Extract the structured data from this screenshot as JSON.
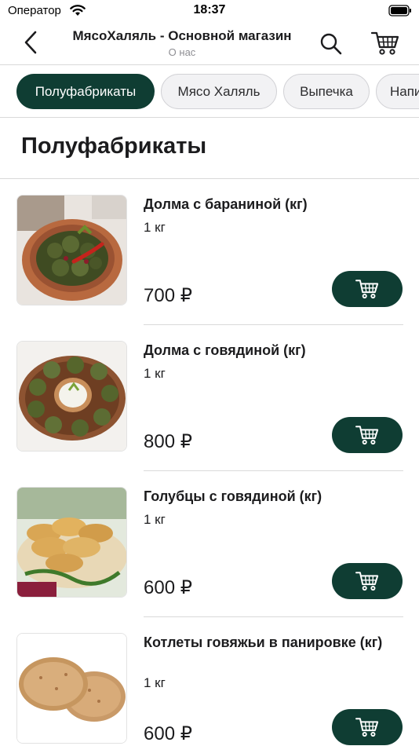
{
  "status_bar": {
    "carrier": "Оператор",
    "time": "18:37"
  },
  "header": {
    "title": "МясоХаляль - Основной магазин",
    "subtitle": "О нас"
  },
  "tabs": [
    {
      "label": "Полуфабрикаты",
      "active": true
    },
    {
      "label": "Мясо Халяль",
      "active": false
    },
    {
      "label": "Выпечка",
      "active": false
    },
    {
      "label": "Напитки",
      "active": false
    }
  ],
  "section": {
    "title": "Полуфабрикаты"
  },
  "products": [
    {
      "name": "Долма с бараниной (кг)",
      "weight": "1 кг",
      "price": "700 ₽",
      "image": "dolma-lamb-photo"
    },
    {
      "name": "Долма с говядиной (кг)",
      "weight": "1 кг",
      "price": "800 ₽",
      "image": "dolma-beef-photo"
    },
    {
      "name": "Голубцы с говядиной (кг)",
      "weight": "1 кг",
      "price": "600 ₽",
      "image": "cabbage-rolls-photo"
    },
    {
      "name": "Котлеты говяжьи в панировке (кг)",
      "weight": "1 кг",
      "price": "600 ₽",
      "image": "breaded-cutlets-photo"
    }
  ],
  "colors": {
    "accent": "#0f3d33",
    "divider": "#d9d9d9",
    "tab_inactive_bg": "#f2f2f4"
  }
}
